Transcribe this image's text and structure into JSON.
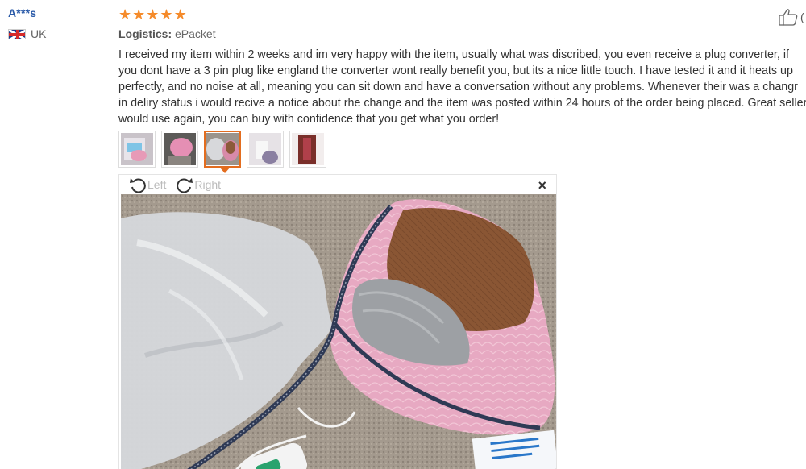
{
  "user": {
    "name": "A***s",
    "country": "UK",
    "flag_icon": "uk-flag-icon"
  },
  "review": {
    "rating": 5,
    "stars": [
      "★",
      "★",
      "★",
      "★",
      "★"
    ],
    "star_color": "#f58b2b",
    "logistics_label": "Logistics:",
    "logistics_value": "ePacket",
    "text": "I received my item within 2 weeks and im very happy with the item, usually what was discribed, you even receive a plug converter, if you dont have a 3 pin plug like england the converter wont really benefit you, but its a nice little touch. I have tested it and it heats up perfectly, and no noise at all, meaning you can sit down and have a conversation without any problems. Whenever their was a changr in deliry status i would recive a notice about rhe change and the item was posted within 24 hours of the order being placed. Great seller would use again, you can buy with confidence that you get what you order!"
  },
  "helpful": {
    "icon": "thumbs-up-icon",
    "count_text": "("
  },
  "thumbnails": [
    {
      "name": "photo-1",
      "active": false
    },
    {
      "name": "photo-2",
      "active": false
    },
    {
      "name": "photo-3",
      "active": true
    },
    {
      "name": "photo-4",
      "active": false
    },
    {
      "name": "photo-5",
      "active": false
    }
  ],
  "viewer": {
    "rotate_left_label": "Left",
    "rotate_right_label": "Right",
    "close_icon": "close-icon",
    "close_glyph": "×"
  },
  "colors": {
    "accent": "#e36d1f",
    "username": "#2a5aa8"
  }
}
